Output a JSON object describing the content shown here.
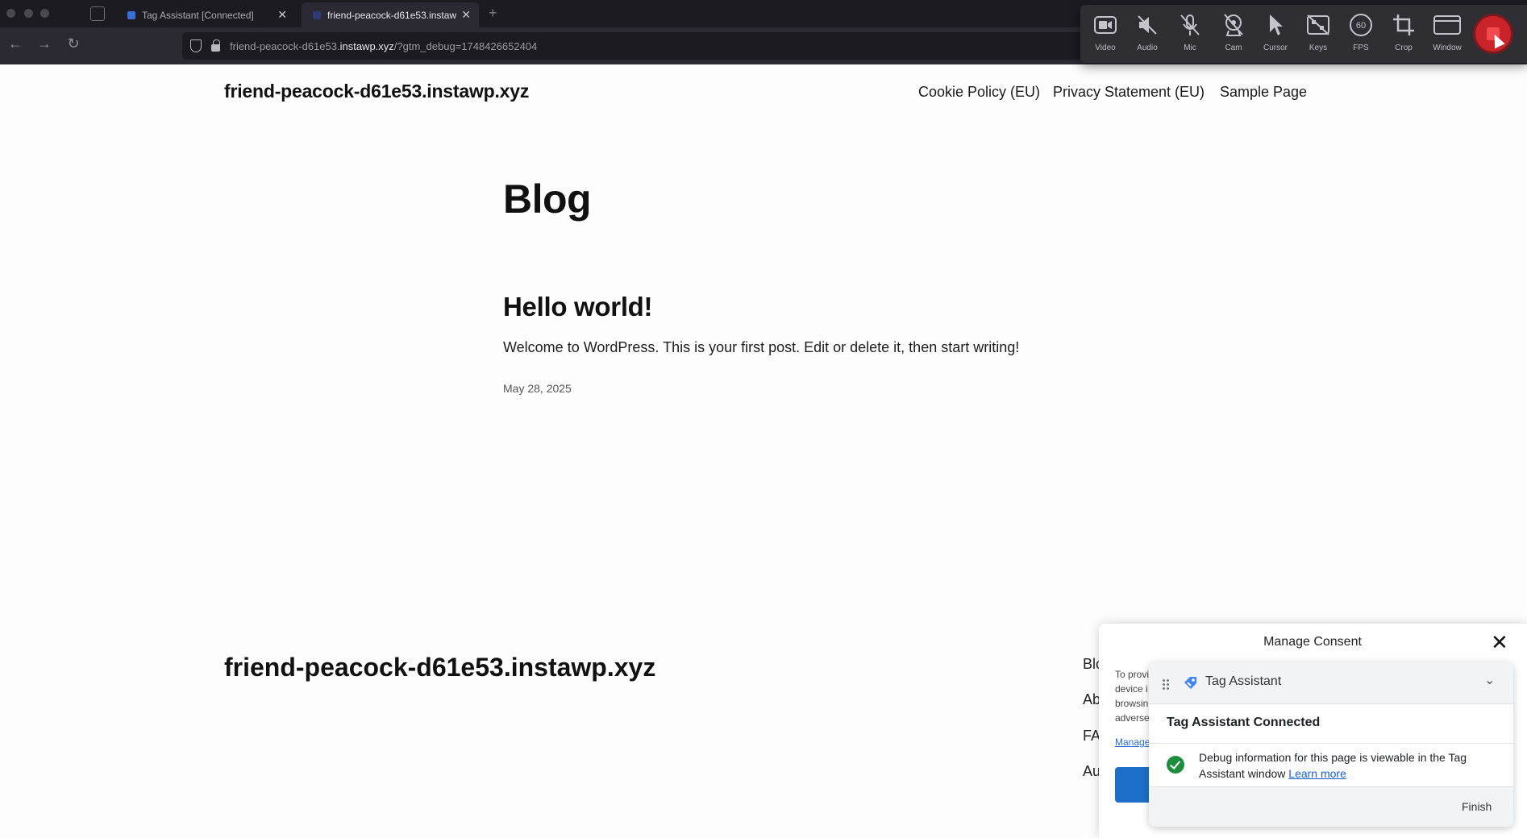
{
  "browser": {
    "tabs": [
      {
        "title": "Tag Assistant [Connected]",
        "active": false
      },
      {
        "title": "friend-peacock-d61e53.instawp.xyz",
        "active": true
      }
    ],
    "url_prefix": "friend-peacock-d61e53.",
    "url_domain": "instawp.xyz",
    "url_suffix": "/?gtm_debug=1748426652404"
  },
  "recorder": {
    "items": [
      {
        "label": "Video",
        "icon": "video-icon"
      },
      {
        "label": "Audio",
        "icon": "audio-muted-icon"
      },
      {
        "label": "Mic",
        "icon": "mic-muted-icon"
      },
      {
        "label": "Cam",
        "icon": "cam-muted-icon"
      },
      {
        "label": "Cursor",
        "icon": "cursor-icon"
      },
      {
        "label": "Keys",
        "icon": "keys-muted-icon"
      },
      {
        "label": "FPS",
        "icon": "fps-icon",
        "value": "60"
      },
      {
        "label": "Crop",
        "icon": "crop-icon"
      },
      {
        "label": "Window",
        "icon": "window-icon"
      }
    ],
    "stop_color": "#c9242a"
  },
  "site": {
    "title": "friend-peacock-d61e53.instawp.xyz",
    "nav": [
      "Cookie Policy (EU)",
      "Privacy Statement (EU)",
      "Sample Page"
    ]
  },
  "main": {
    "heading": "Blog",
    "post": {
      "title": "Hello world!",
      "excerpt": "Welcome to WordPress. This is your first post. Edit or delete it, then start writing!",
      "date": "May 28, 2025"
    }
  },
  "footer": {
    "title": "friend-peacock-d61e53.instawp.xyz",
    "links": [
      "Blo",
      "Ab",
      "FA",
      "Au"
    ]
  },
  "consent": {
    "title": "Manage Consent",
    "text_lines": [
      "To provi",
      "device i",
      "browsin",
      "adverse"
    ],
    "link": "Manage"
  },
  "tag_assistant": {
    "name": "Tag Assistant",
    "status": "Tag Assistant Connected",
    "message": "Debug information for this page is viewable in the Tag Assistant window",
    "learn_more": "Learn more",
    "finish": "Finish"
  }
}
